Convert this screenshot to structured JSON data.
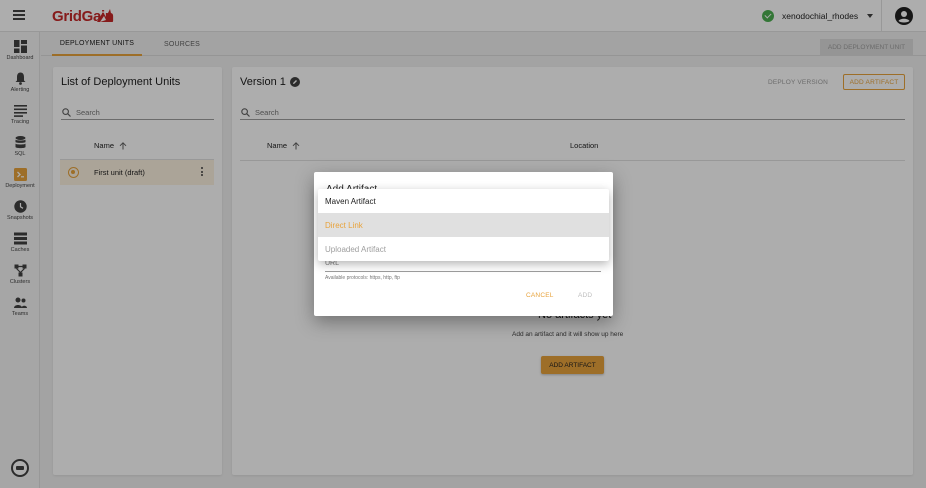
{
  "app": {
    "logo_text": "GridGain",
    "brand_color": "#c62828",
    "accent_color": "#e8a33c"
  },
  "header": {
    "username": "xenodochial_rhodes",
    "status_icon": "check-circle-icon",
    "account_icon": "account-circle-icon"
  },
  "sidebar": {
    "items": [
      {
        "label": "Dashboard",
        "icon": "dashboard-icon"
      },
      {
        "label": "Alerting",
        "icon": "bell-icon"
      },
      {
        "label": "Tracing",
        "icon": "tracing-icon"
      },
      {
        "label": "SQL",
        "icon": "database-icon"
      },
      {
        "label": "Deployment",
        "icon": "deployment-icon"
      },
      {
        "label": "Snapshots",
        "icon": "clock-icon"
      },
      {
        "label": "Caches",
        "icon": "caches-icon"
      },
      {
        "label": "Clusters",
        "icon": "clusters-icon"
      },
      {
        "label": "Teams",
        "icon": "teams-icon"
      }
    ],
    "footer_badge_icon": "cluster-badge-icon"
  },
  "tabs": [
    {
      "label": "DEPLOYMENT UNITS"
    },
    {
      "label": "SOURCES"
    }
  ],
  "toolbar": {
    "add_unit_label": "ADD DEPLOYMENT UNIT"
  },
  "left_panel": {
    "title": "List of Deployment Units",
    "search_placeholder": "Search",
    "column_name": "Name",
    "units": [
      {
        "label": "First unit (draft)",
        "selected": true
      }
    ]
  },
  "right_panel": {
    "title": "Version 1",
    "deploy_label": "DEPLOY VERSION",
    "add_artifact_label": "ADD ARTIFACT",
    "search_placeholder": "Search",
    "columns": [
      "Name",
      "Location"
    ],
    "empty_title": "No artifacts yet",
    "empty_subtitle": "Add an artifact and it will show up here",
    "empty_button_label": "ADD ARTIFACT"
  },
  "dialog": {
    "title": "Add Artifact",
    "url_label": "URL",
    "url_hint": "Available protocols: https, http, ftp",
    "cancel_label": "CANCEL",
    "add_label": "ADD",
    "type_options": [
      {
        "label": "Maven Artifact"
      },
      {
        "label": "Direct Link"
      },
      {
        "label": "Uploaded Artifact"
      }
    ],
    "selected_type": "Direct Link"
  }
}
